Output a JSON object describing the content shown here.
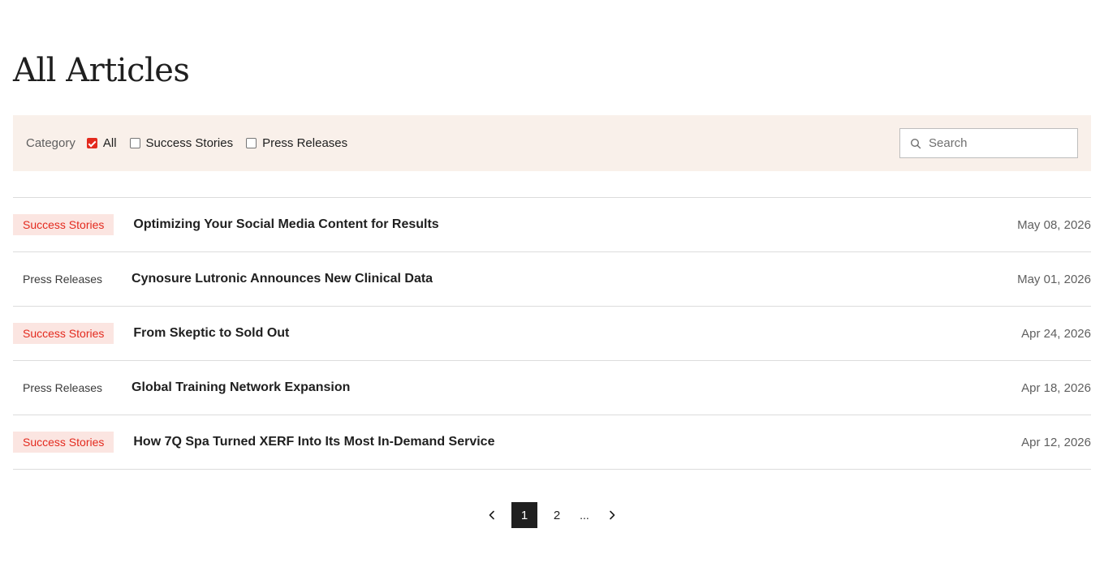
{
  "page": {
    "title": "All Articles"
  },
  "filters": {
    "label": "Category",
    "options": [
      {
        "label": "All",
        "checked": true
      },
      {
        "label": "Success Stories",
        "checked": false
      },
      {
        "label": "Press Releases",
        "checked": false
      }
    ],
    "search": {
      "placeholder": "Search",
      "value": ""
    }
  },
  "articles": [
    {
      "category": "Success Stories",
      "title": "Optimizing Your Social Media Content for Results",
      "date": "May 08, 2026"
    },
    {
      "category": "Press Releases",
      "title": "Cynosure Lutronic Announces New Clinical Data",
      "date": "May 01, 2026"
    },
    {
      "category": "Success Stories",
      "title": "From Skeptic to Sold Out",
      "date": "Apr 24, 2026"
    },
    {
      "category": "Press Releases",
      "title": "Global Training Network Expansion",
      "date": "Apr 18, 2026"
    },
    {
      "category": "Success Stories",
      "title": "How 7Q Spa Turned XERF Into Its Most In-Demand Service",
      "date": "Apr 12, 2026"
    }
  ],
  "pagination": {
    "pages": [
      "1",
      "2"
    ],
    "current": "1",
    "ellipsis": "..."
  },
  "icons": {
    "search": "search-icon",
    "prev": "chevron-left-icon",
    "next": "chevron-right-icon"
  },
  "colors": {
    "accent": "#e32a1e",
    "filter_bg": "#f9f0ea",
    "tag_bg": "#fbe5e1",
    "text": "#1f1f1f"
  }
}
